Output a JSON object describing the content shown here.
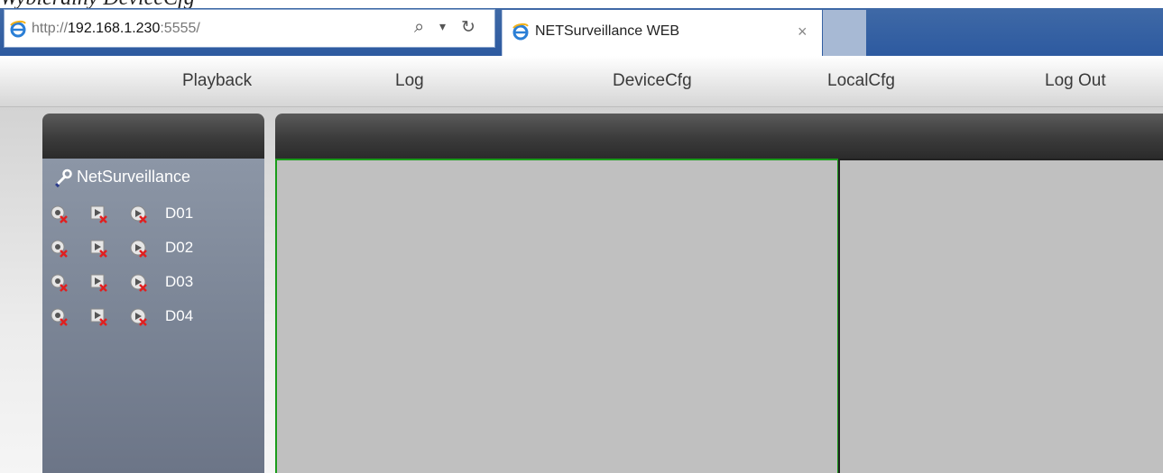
{
  "caption": "Wybierainy DeviceCfg",
  "browser": {
    "address_prefix": "http://",
    "address_host": "192.168.1.230",
    "address_port": ":5555/",
    "tab_title": "NETSurveillance WEB",
    "tab_close": "×",
    "search_glyph": "⌕",
    "dropdown_glyph": "▾",
    "refresh_glyph": "↻"
  },
  "nav": {
    "items": [
      "Playback",
      "Log",
      "DeviceCfg",
      "LocalCfg",
      "Log Out"
    ]
  },
  "tree": {
    "root_label": "NetSurveillance",
    "root_icon": "wrench-icon",
    "channel_icons": [
      "record-off-icon",
      "play-off-icon",
      "alarm-off-icon"
    ],
    "channels": [
      {
        "label": "D01"
      },
      {
        "label": "D02"
      },
      {
        "label": "D03"
      },
      {
        "label": "D04"
      }
    ]
  },
  "colors": {
    "selected_cell_border": "#1a9c1a",
    "panel": "#7b8596",
    "video_bg": "#c0c0c0"
  }
}
